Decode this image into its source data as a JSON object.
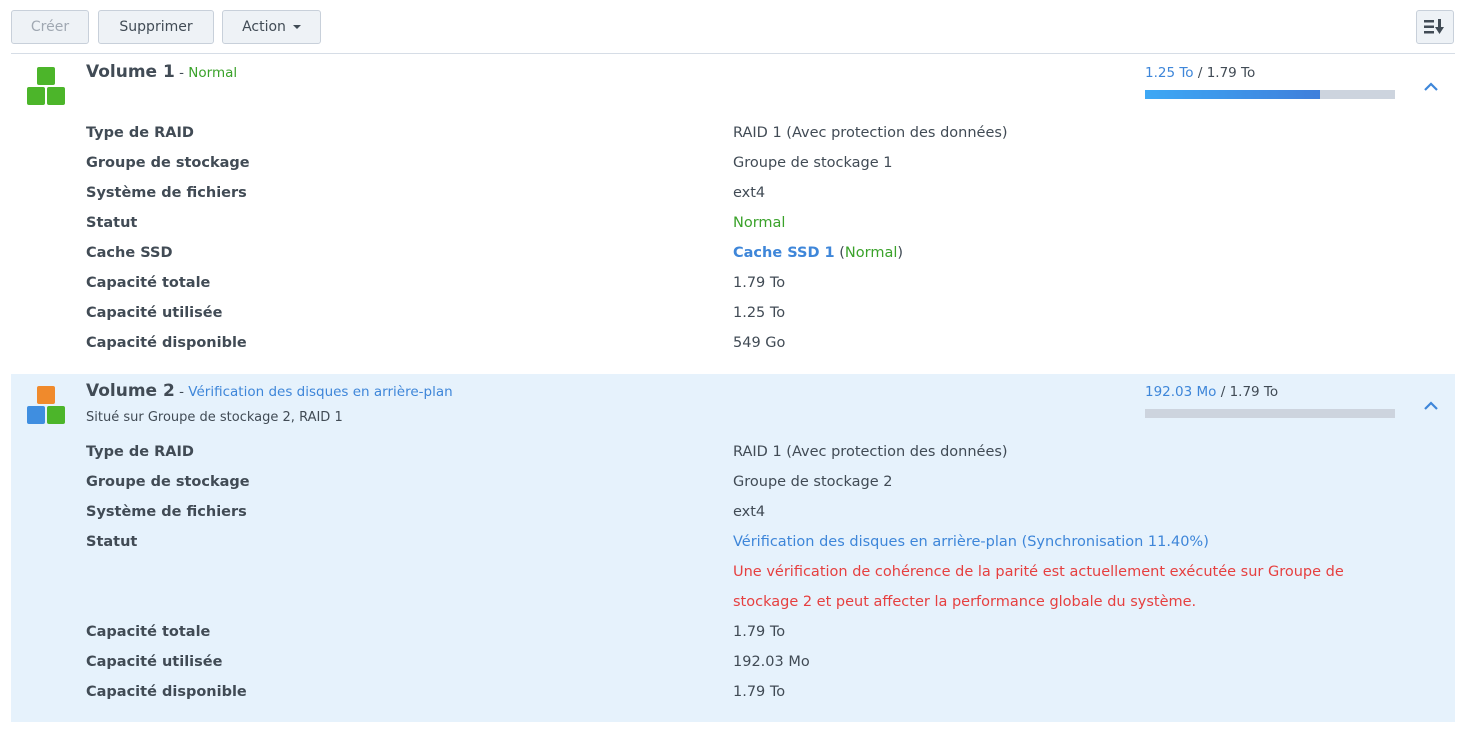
{
  "toolbar": {
    "create": "Créer",
    "delete": "Supprimer",
    "action": "Action",
    "sort_icon": "sort-list-icon"
  },
  "volumes": [
    {
      "name": "Volume 1",
      "sep": " - ",
      "status": "Normal",
      "used": "1.25 To",
      "total": "1.79 To",
      "usage_fraction": 0.7,
      "rows": [
        {
          "label": "Type de RAID",
          "value": "RAID 1 (Avec protection des données)"
        },
        {
          "label": "Groupe de stockage",
          "value": "Groupe de stockage 1"
        },
        {
          "label": "Système de fichiers",
          "value": "ext4"
        },
        {
          "label": "Statut",
          "value": "Normal"
        },
        {
          "label": "Cache SSD",
          "link": "Cache SSD 1",
          "open": " (",
          "status": "Normal",
          "close": ")"
        },
        {
          "label": "Capacité totale",
          "value": "1.79 To"
        },
        {
          "label": "Capacité utilisée",
          "value": "1.25 To"
        },
        {
          "label": "Capacité disponible",
          "value": "549 Go"
        }
      ]
    },
    {
      "name": "Volume 2",
      "sep": " - ",
      "status": "Vérification des disques en arrière-plan",
      "subtitle": "Situé sur Groupe de stockage 2, RAID 1",
      "used": "192.03 Mo",
      "total": "1.79 To",
      "usage_fraction": 0.0001,
      "rows": [
        {
          "label": "Type de RAID",
          "value": "RAID 1 (Avec protection des données)"
        },
        {
          "label": "Groupe de stockage",
          "value": "Groupe de stockage 2"
        },
        {
          "label": "Système de fichiers",
          "value": "ext4"
        },
        {
          "label": "Statut",
          "value": "Vérification des disques en arrière-plan (Synchronisation 11.40%)"
        },
        {
          "label": "",
          "warning1": "Une vérification de cohérence de la parité est actuellement exécutée sur Groupe de",
          "warning2": "stockage 2 et peut affecter la performance globale du système."
        },
        {
          "label": "Capacité totale",
          "value": "1.79 To"
        },
        {
          "label": "Capacité utilisée",
          "value": "192.03 Mo"
        },
        {
          "label": "Capacité disponible",
          "value": "1.79 To"
        }
      ]
    }
  ],
  "sep_slash": " / "
}
